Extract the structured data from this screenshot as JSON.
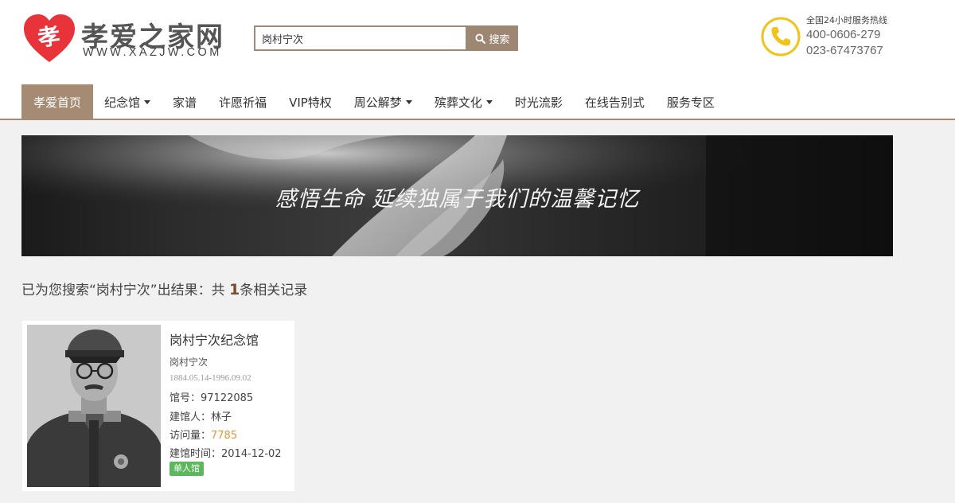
{
  "header": {
    "logo_char": "孝",
    "site_title": "孝爱之家网",
    "site_url": "WWW.XAZJW.COM",
    "search": {
      "value": "岗村宁次",
      "placeholder": "",
      "button_label": "搜索"
    },
    "hotline": {
      "label": "全国24小时服务热线",
      "phone1": "400-0606-279",
      "phone2": "023-67473767"
    }
  },
  "nav": {
    "items": [
      {
        "label": "孝爱首页",
        "active": true,
        "dropdown": false
      },
      {
        "label": "纪念馆",
        "active": false,
        "dropdown": true
      },
      {
        "label": "家谱",
        "active": false,
        "dropdown": false
      },
      {
        "label": "许愿祈福",
        "active": false,
        "dropdown": false
      },
      {
        "label": "VIP特权",
        "active": false,
        "dropdown": false
      },
      {
        "label": "周公解梦",
        "active": false,
        "dropdown": true
      },
      {
        "label": "殡葬文化",
        "active": false,
        "dropdown": true
      },
      {
        "label": "时光流影",
        "active": false,
        "dropdown": false
      },
      {
        "label": "在线告别式",
        "active": false,
        "dropdown": false
      },
      {
        "label": "服务专区",
        "active": false,
        "dropdown": false
      }
    ]
  },
  "banner": {
    "text": "感悟生命  延续独属于我们的温馨记忆"
  },
  "results": {
    "prefix": "已为您搜索“岗村宁次”出结果：共 ",
    "count": "1",
    "suffix": "条相关记录"
  },
  "memorial": {
    "title": "岗村宁次纪念馆",
    "name": "岗村宁次",
    "dates": "1884.05.14-1996.09.02",
    "id_label": "馆号：",
    "id_value": "97122085",
    "founder_label": "建馆人：",
    "founder_value": "林子",
    "visits_label": "访问量：",
    "visits_value": "7785",
    "created_label": "建馆时间：",
    "created_value": "2014-12-02",
    "badge": "单人馆"
  },
  "colors": {
    "accent": "#a58b73",
    "logo_red": "#e8333a",
    "phone_yellow": "#f0c419",
    "badge_green": "#5cb85c",
    "visits_orange": "#e8953a"
  }
}
